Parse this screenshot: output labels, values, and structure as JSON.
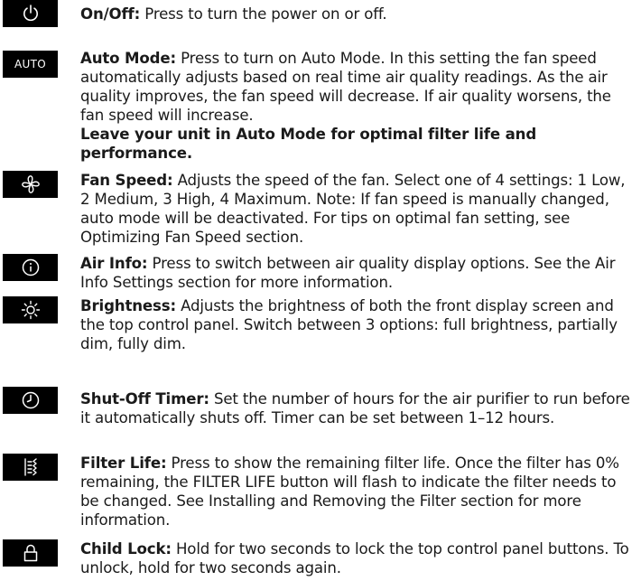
{
  "items": [
    {
      "icon": "power-icon",
      "term": "On/Off:",
      "text": " Press to turn the power on or off."
    },
    {
      "icon": "auto-label",
      "icon_text": "AUTO",
      "term": "Auto Mode:",
      "text": " Press to turn on Auto Mode. In this setting the fan speed automatically adjusts based on real time air quality readings. As the air quality improves, the fan speed will decrease. If air quality worsens, the fan speed will increase.",
      "emphasis": "Leave your unit in Auto Mode for optimal filter life and performance."
    },
    {
      "icon": "fan-icon",
      "term": "Fan Speed:",
      "text": " Adjusts the speed of the fan. Select one of 4 settings: 1 Low, 2 Medium, 3 High, 4 Maximum. Note: If fan speed is manually changed, auto mode will be deactivated. For tips on optimal fan setting, see Optimizing Fan Speed section."
    },
    {
      "icon": "info-icon",
      "term": "Air Info:",
      "text": " Press to switch between air quality display options. See the Air Info Settings section for more information."
    },
    {
      "icon": "sun-icon",
      "term": "Brightness:",
      "text": " Adjusts the brightness of both the front display screen and the top control panel. Switch between 3 options: full brightness, partially dim, fully dim."
    },
    {
      "icon": "clock-icon",
      "term": "Shut-Off Timer:",
      "text": " Set the number of hours for the air purifier to run before it automatically shuts off. Timer can be set between 1–12 hours."
    },
    {
      "icon": "filter-icon",
      "term": "Filter Life:",
      "text": " Press to show the remaining filter life. Once the filter has 0% remaining, the FILTER LIFE button will flash to indicate the filter needs to be changed. See Installing and Removing the Filter section for more information."
    },
    {
      "icon": "lock-icon",
      "term": "Child Lock:",
      "text": " Hold for two seconds to lock the top control panel buttons. To unlock, hold for two seconds again."
    }
  ]
}
